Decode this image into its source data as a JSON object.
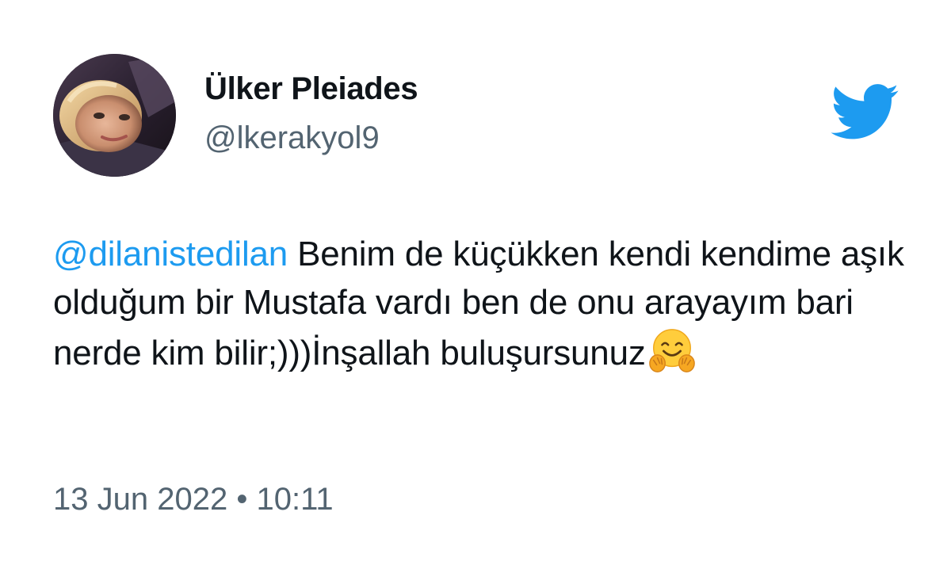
{
  "author": {
    "display_name": "Ülker Pleiades",
    "handle": "@lkerakyol9"
  },
  "tweet": {
    "mention": "@dilanistedilan",
    "text": " Benim de küçükken kendi kendime aşık olduğum bir Mustafa vardı ben de onu arayayım bari nerde kim bilir;)))İnşallah buluşursunuz",
    "emoji": "hugging-face",
    "date": "13 Jun 2022",
    "separator": "•",
    "time": "10:11"
  },
  "icons": {
    "logo": "twitter-bird-icon"
  },
  "colors": {
    "mention": "#1d9bf0",
    "twitter_blue": "#1d9bf0",
    "secondary_text": "#536471",
    "primary_text": "#0f1419"
  }
}
